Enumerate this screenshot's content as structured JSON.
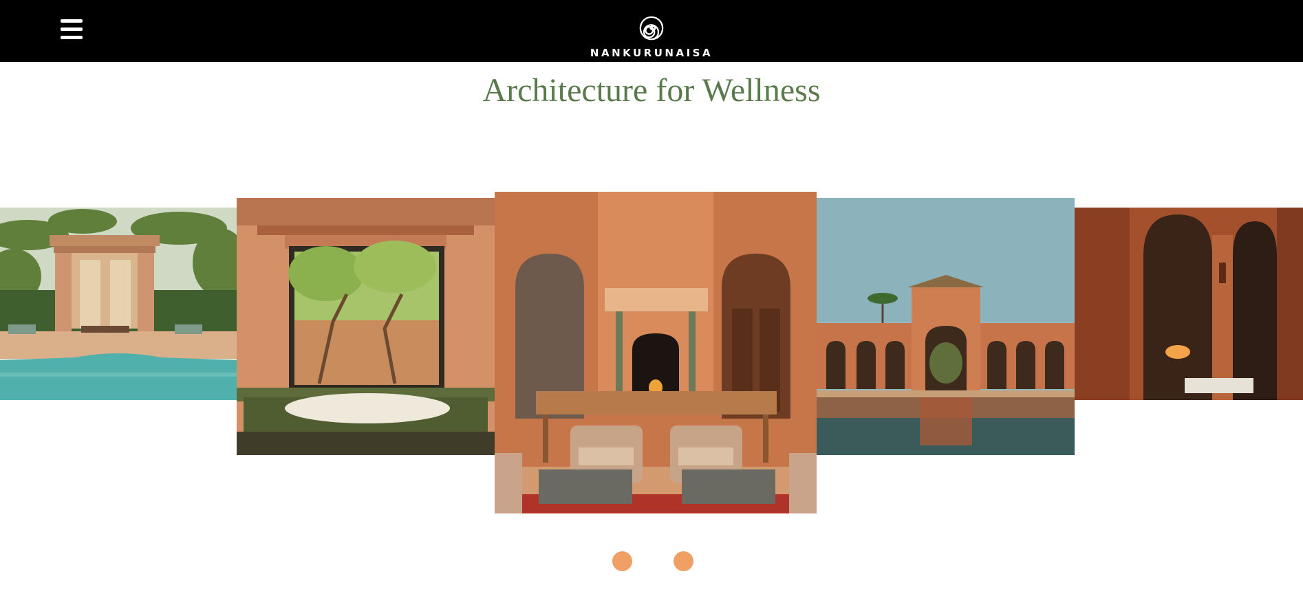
{
  "header": {
    "menu_icon": "hamburger-menu-icon",
    "logo_icon": "spiral-icon",
    "brand_name": "NANKURUNAISA"
  },
  "page": {
    "title": "Architecture for Wellness"
  },
  "carousel": {
    "slides": [
      {
        "subject": "poolside pavilion with palm trees"
      },
      {
        "subject": "bathtub beside garden window"
      },
      {
        "subject": "lounge with fireplace and armchairs"
      },
      {
        "subject": "arched courtyard with reflecting pool"
      },
      {
        "subject": "arcade with arches and fire"
      }
    ],
    "dots": 2
  },
  "colors": {
    "header_bg": "#000000",
    "title_green": "#5a7a4c",
    "dot_orange": "#f0a065"
  }
}
